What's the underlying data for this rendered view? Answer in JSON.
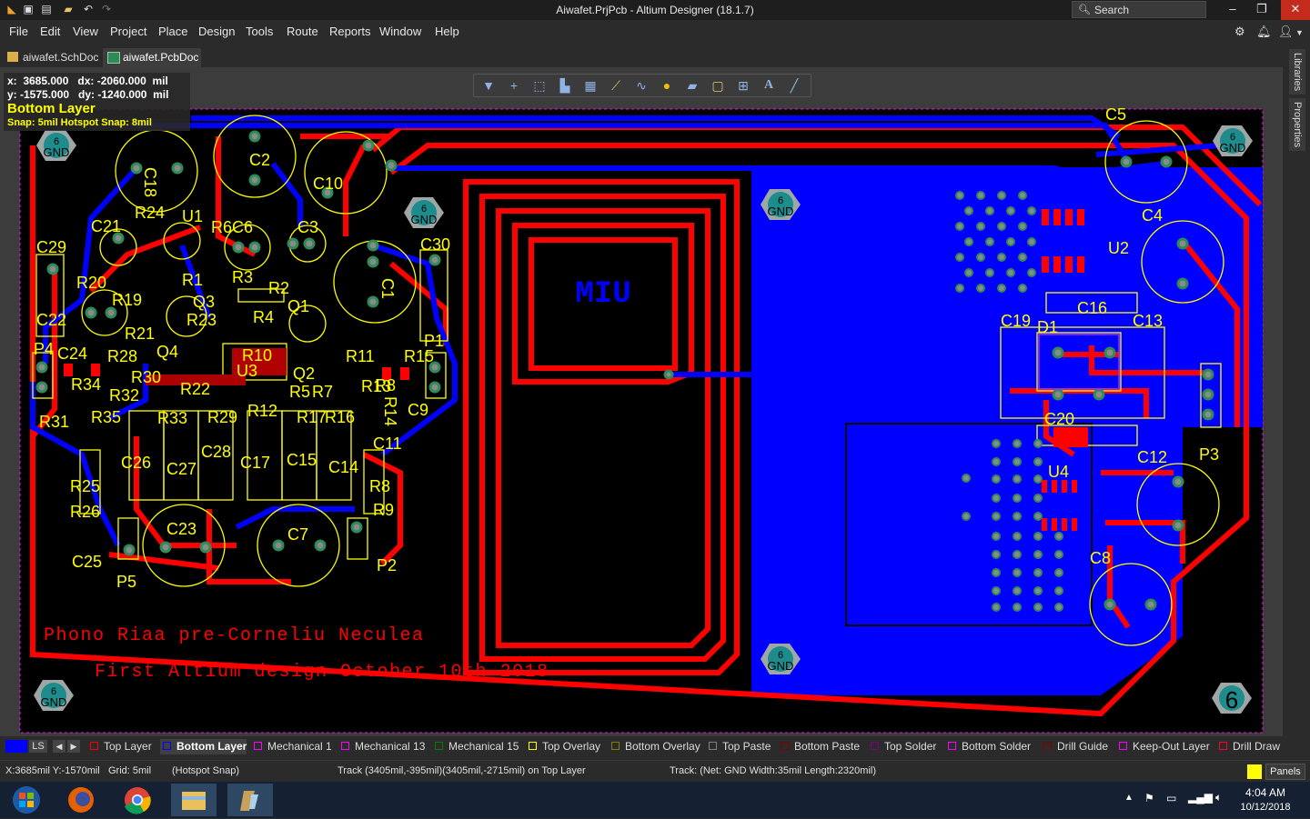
{
  "window": {
    "title": "Aiwafet.PrjPcb - Altium Designer (18.1.7)",
    "search_placeholder": "Search"
  },
  "menu": [
    "File",
    "Edit",
    "View",
    "Project",
    "Place",
    "Design",
    "Tools",
    "Route",
    "Reports",
    "Window",
    "Help"
  ],
  "tabs": [
    {
      "label": "aiwafet.SchDoc",
      "active": false
    },
    {
      "label": "aiwafet.PcbDoc",
      "active": true
    }
  ],
  "right_panels": [
    "Libraries",
    "Properties"
  ],
  "hud": {
    "line1": "x:  3685.000   dx: -2060.000  mil",
    "line2": "y: -1575.000   dy: -1240.000  mil",
    "layer": "Bottom Layer",
    "snap": "Snap: 5mil Hotspot Snap: 8mil"
  },
  "board": {
    "text_layer_top": "MIU",
    "silk_line1": "Phono Riaa pre-Corneliu Neculea",
    "silk_line2": "First Altium design October 10th-2018",
    "hole_label_num": "6",
    "hole_label_net": "GND",
    "designators": [
      "C5",
      "C4",
      "U2",
      "C16",
      "C13",
      "C19",
      "D1",
      "C20",
      "C12",
      "U4",
      "C8",
      "P3",
      "C2",
      "C10",
      "C18",
      "R24",
      "U1",
      "C21",
      "R6",
      "C6",
      "C3",
      "C29",
      "R20",
      "R1",
      "R3",
      "R2",
      "R19",
      "Q3",
      "C22",
      "R23",
      "R4",
      "Q1",
      "C1",
      "C30",
      "R21",
      "Q4",
      "P4",
      "C24",
      "R28",
      "R10",
      "R11",
      "R15",
      "R34",
      "R30",
      "U3",
      "Q2",
      "R13",
      "P1",
      "R32",
      "R22",
      "R5",
      "R7",
      "R8",
      "R14",
      "C9",
      "R31",
      "R35",
      "R33",
      "R29",
      "R12",
      "R17",
      "R16",
      "C11",
      "C26",
      "C27",
      "C28",
      "C17",
      "C15",
      "C14",
      "R25",
      "R8",
      "R26",
      "R9",
      "C23",
      "C7",
      "C25",
      "P5",
      "P2"
    ]
  },
  "layers": [
    {
      "name": "Top Layer",
      "color": "#ff0000"
    },
    {
      "name": "Bottom Layer",
      "color": "#0000ff",
      "active": true
    },
    {
      "name": "Mechanical 1",
      "color": "#ff00ff"
    },
    {
      "name": "Mechanical 13",
      "color": "#ff00ff"
    },
    {
      "name": "Mechanical 15",
      "color": "#008000"
    },
    {
      "name": "Top Overlay",
      "color": "#ffff00"
    },
    {
      "name": "Bottom Overlay",
      "color": "#808000"
    },
    {
      "name": "Top Paste",
      "color": "#808080"
    },
    {
      "name": "Bottom Paste",
      "color": "#800000"
    },
    {
      "name": "Top Solder",
      "color": "#800080"
    },
    {
      "name": "Bottom Solder",
      "color": "#ff00ff"
    },
    {
      "name": "Drill Guide",
      "color": "#800000"
    },
    {
      "name": "Keep-Out Layer",
      "color": "#ff00ff"
    },
    {
      "name": "Drill Draw",
      "color": "#ff002a"
    }
  ],
  "layer_set_label": "LS",
  "status": {
    "coords": "X:3685mil Y:-1570mil",
    "grid": "Grid: 5mil",
    "snap": "(Hotspot Snap)",
    "track": "Track (3405mil,-395mil)(3405mil,-2715mil) on Top Layer",
    "net": "Track: (Net: GND Width:35mil Length:2320mil)",
    "panels_label": "Panels"
  },
  "tray": {
    "time": "4:04 AM",
    "date": "10/12/2018"
  }
}
